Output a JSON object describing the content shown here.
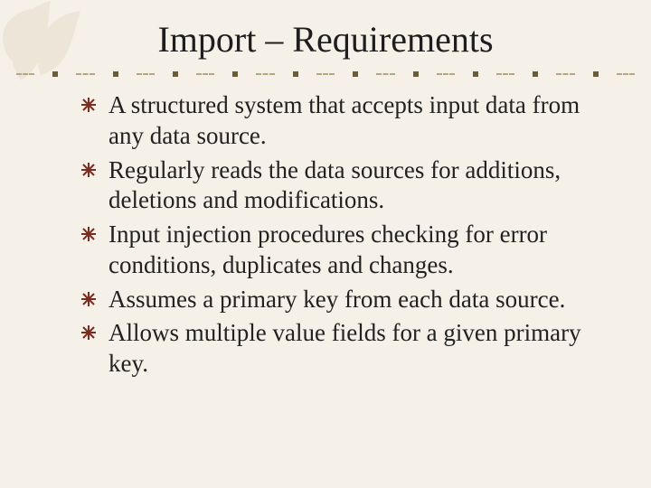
{
  "title": "Import – Requirements",
  "bullets": [
    "A structured system that accepts input data from any data source.",
    "Regularly reads the data sources for additions, deletions and modifications.",
    "Input injection procedures checking for error conditions, duplicates and changes.",
    "Assumes a primary key from each data source.",
    "Allows multiple value fields for a given primary key."
  ],
  "colors": {
    "background": "#f5f0e8",
    "bullet": "#7a2c1f",
    "divider": "#b5a77f"
  }
}
